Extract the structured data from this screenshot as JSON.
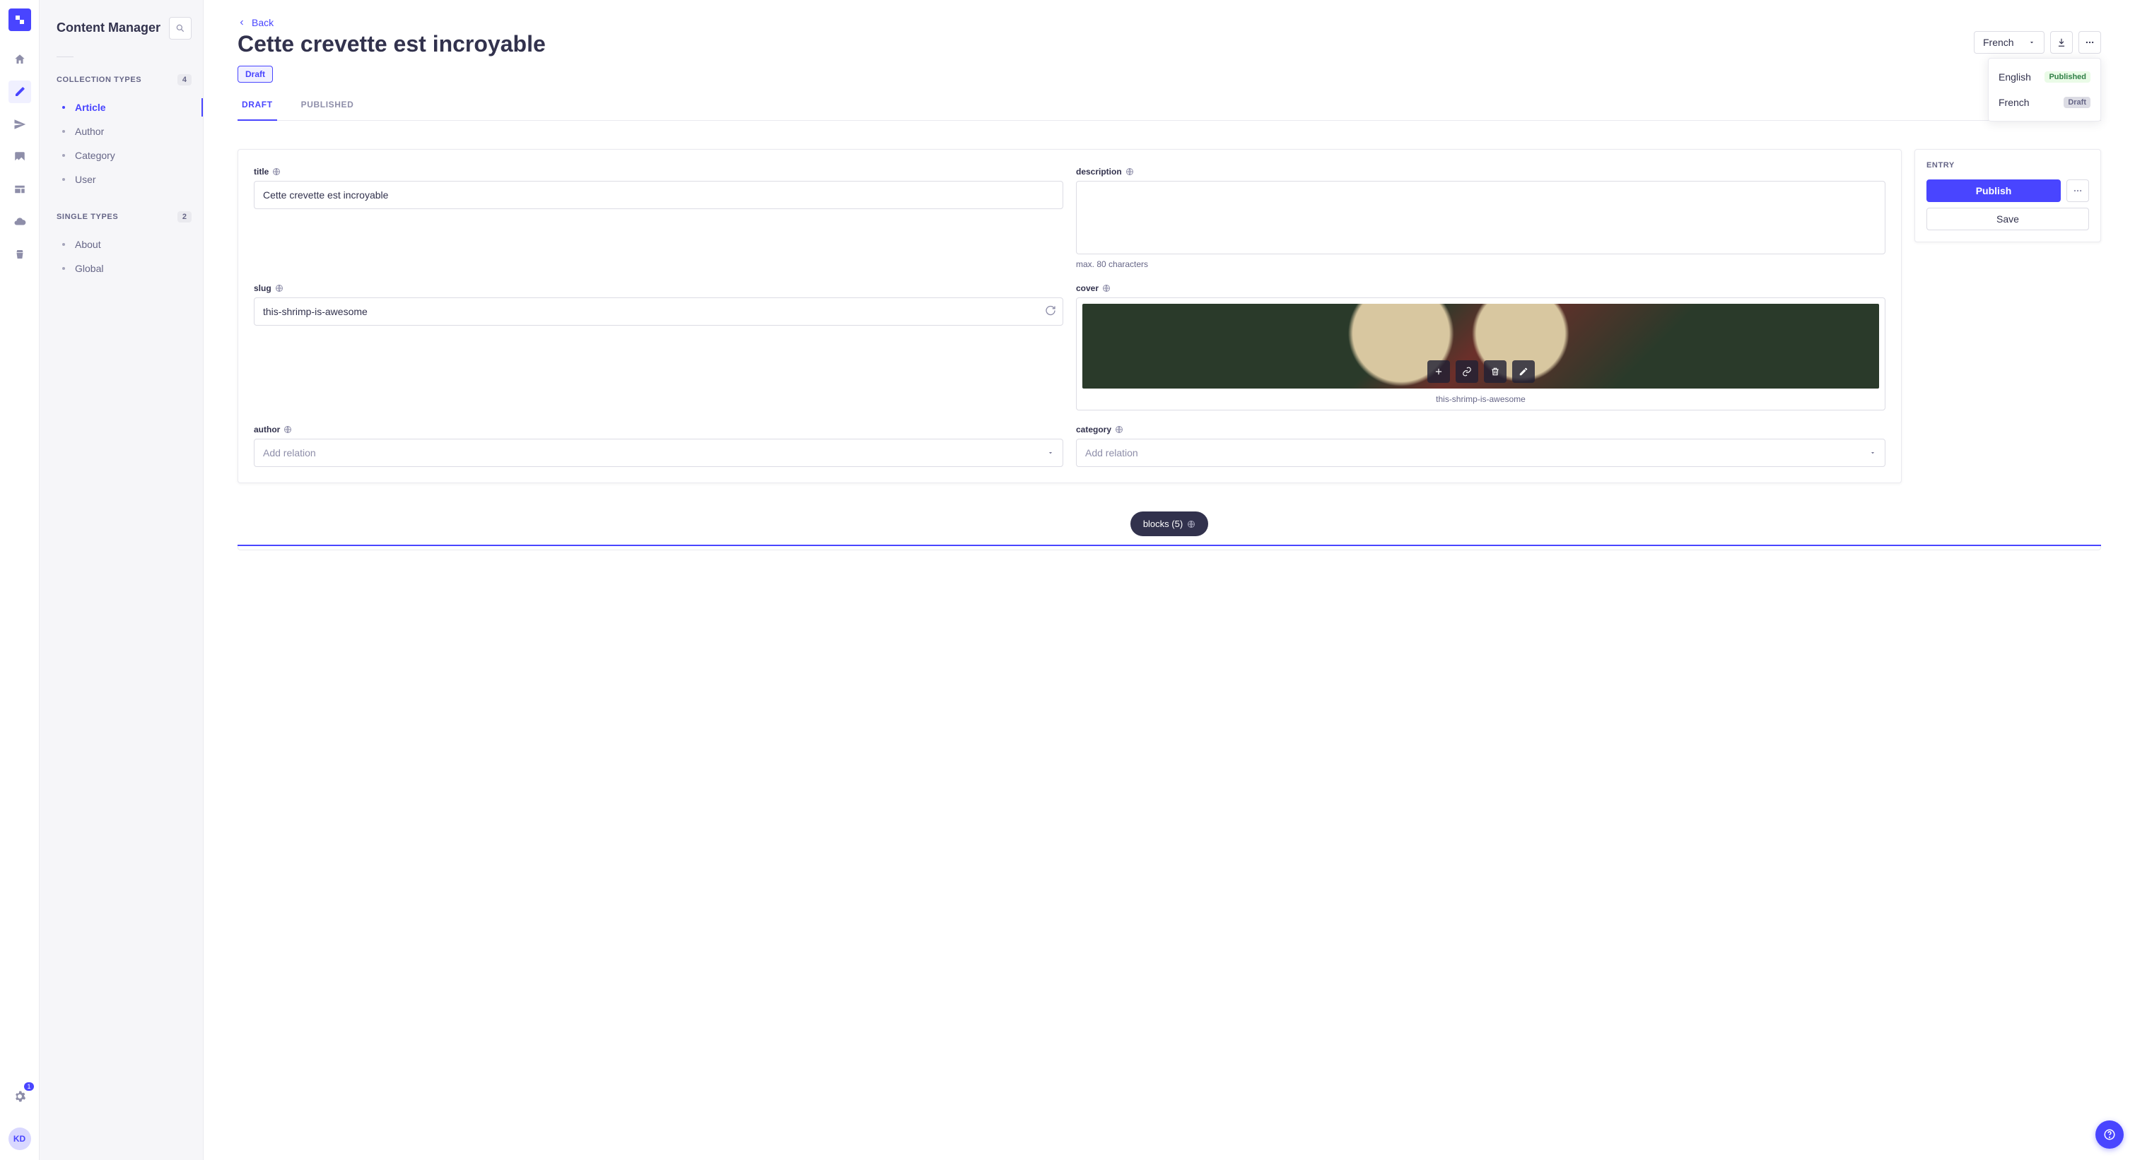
{
  "app": {
    "title": "Content Manager"
  },
  "iconNav": {
    "badge": "1",
    "avatar": "KD"
  },
  "sidebar": {
    "groups": [
      {
        "title": "Collection Types",
        "count": "4",
        "items": [
          {
            "label": "Article",
            "active": true
          },
          {
            "label": "Author"
          },
          {
            "label": "Category"
          },
          {
            "label": "User"
          }
        ]
      },
      {
        "title": "Single Types",
        "count": "2",
        "items": [
          {
            "label": "About"
          },
          {
            "label": "Global"
          }
        ]
      }
    ]
  },
  "header": {
    "back": "Back",
    "title": "Cette crevette est incroyable",
    "status": "Draft",
    "locale_selected": "French",
    "locales": [
      {
        "name": "English",
        "status": "Published",
        "statusClass": "published"
      },
      {
        "name": "French",
        "status": "Draft",
        "statusClass": "draft"
      }
    ]
  },
  "tabs": {
    "draft": "Draft",
    "published": "Published"
  },
  "fields": {
    "title": {
      "label": "title",
      "value": "Cette crevette est incroyable"
    },
    "description": {
      "label": "description",
      "helper": "max. 80 characters"
    },
    "slug": {
      "label": "slug",
      "value": "this-shrimp-is-awesome"
    },
    "cover": {
      "label": "cover",
      "filename": "this-shrimp-is-awesome"
    },
    "author": {
      "label": "author",
      "placeholder": "Add relation"
    },
    "category": {
      "label": "category",
      "placeholder": "Add relation"
    }
  },
  "blocks": {
    "label": "blocks (5)"
  },
  "entry": {
    "title": "Entry",
    "publish": "Publish",
    "save": "Save"
  }
}
